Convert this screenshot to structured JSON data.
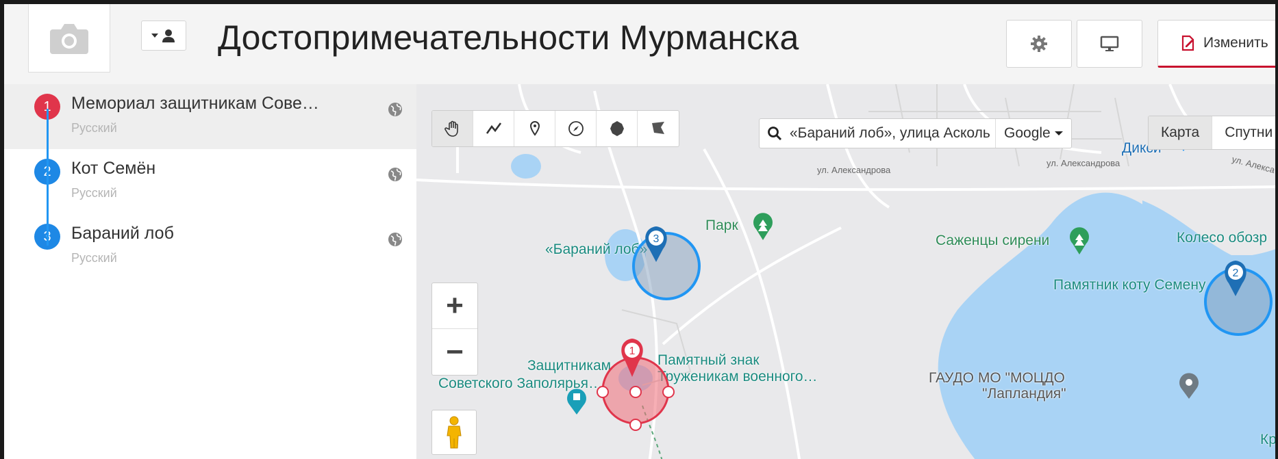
{
  "header": {
    "title": "Достопримечательности Мурманска",
    "edit_label": "Изменить"
  },
  "sidebar": {
    "items": [
      {
        "number": "1",
        "title": "Мемориал защитникам Сове…",
        "language": "Русский",
        "color": "#e0354b"
      },
      {
        "number": "2",
        "title": "Кот Семён",
        "language": "Русский",
        "color": "#1e88e5"
      },
      {
        "number": "3",
        "title": "Бараний лоб",
        "language": "Русский",
        "color": "#1e88e5"
      }
    ]
  },
  "map": {
    "search": {
      "value": "«Бараний лоб», улица Асколь",
      "provider": "Google"
    },
    "map_types": [
      "Карта",
      "Спутни"
    ],
    "zoom": {
      "in": "+",
      "out": "−"
    },
    "tools": [
      "hand-icon",
      "polyline-icon",
      "marker-icon",
      "compass-icon",
      "circle-icon",
      "polygon-icon"
    ],
    "labels": {
      "park": "Парк",
      "baraniy": "«Бараний лоб»",
      "sazhentsy": "Саженцы сирени",
      "koleso": "Колесо обозр",
      "pamyatnik_kotu": "Памятник коту Семену",
      "zashchitnikam_1": "Защитникам",
      "zashchitnikam_2": "Советского Заполярья…",
      "pamyatny_1": "Памятный знак",
      "pamyatny_2": "Труженикам военного…",
      "gaudo_1": "ГАУДО МО \"МОЦДО",
      "gaudo_2": "\"Лапландия\"",
      "diksi": "Дикси",
      "kr": "Кр",
      "street_1": "ул. Александрова",
      "street_2": "ул. Александрова",
      "street_3": "ул. Алекса"
    },
    "markers": [
      {
        "number": "3",
        "color": "#1e6fb5"
      },
      {
        "number": "2",
        "color": "#1e6fb5"
      },
      {
        "number": "1",
        "color": "#e0354b"
      }
    ]
  },
  "colors": {
    "accent_red": "#c8102e",
    "timeline_blue": "#2196f3",
    "water": "#a9d3f5"
  }
}
